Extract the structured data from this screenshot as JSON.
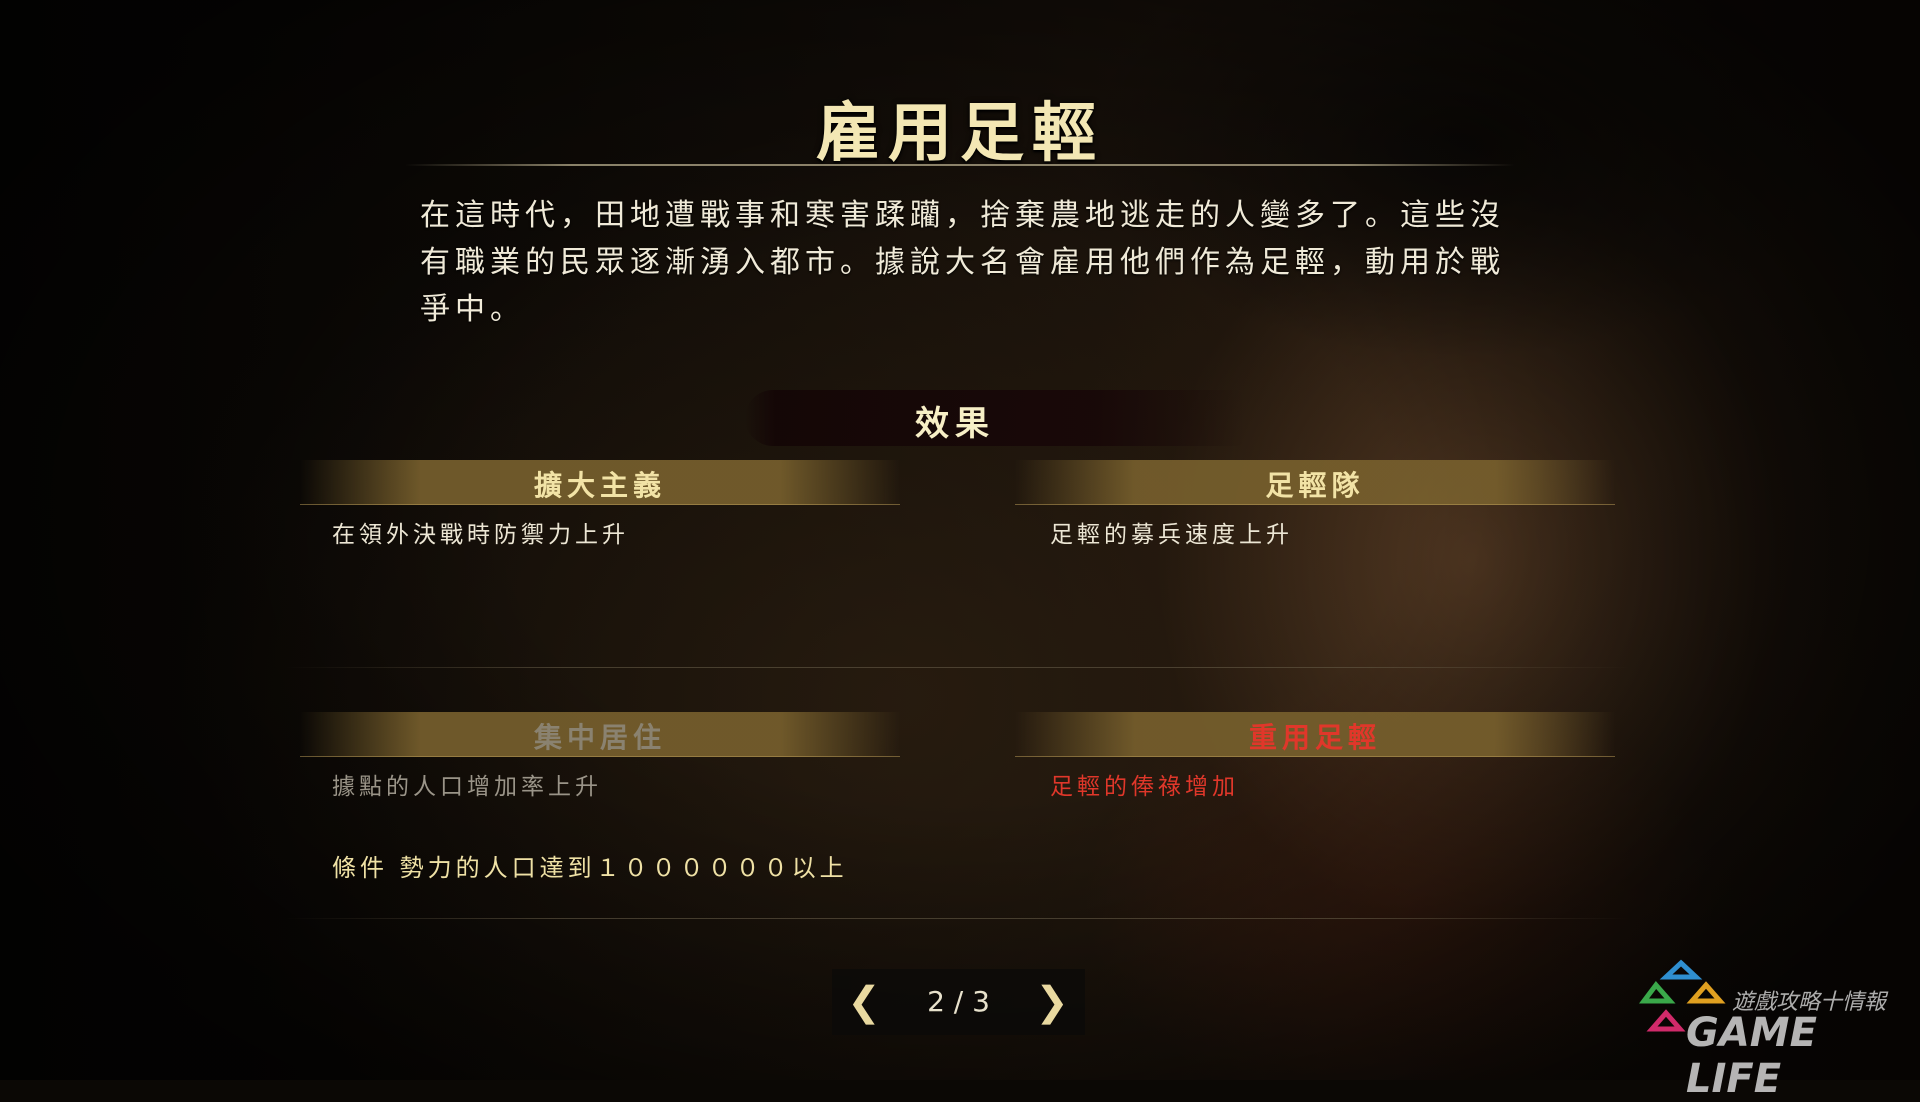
{
  "screen": {
    "title": "雇用足輕",
    "description": "在這時代，田地遭戰事和寒害蹂躪，捨棄農地逃走的人變多了。這些沒有職業的民眾逐漸湧入都市。據說大名會雇用他們作為足輕，動用於戰爭中。",
    "effect_heading": "效果"
  },
  "policies": [
    {
      "name": "擴大主義",
      "effect": "在領外決戰時防禦力上升",
      "state": "normal",
      "name_color": "#f2e3a6",
      "effect_color": "#ece6d4"
    },
    {
      "name": "足輕隊",
      "effect": "足輕的募兵速度上升",
      "state": "normal",
      "name_color": "#f2e3a6",
      "effect_color": "#ece6d4"
    },
    {
      "name": "集中居住",
      "effect": "據點的人口增加率上升",
      "state": "locked",
      "name_color": "#8a8270",
      "effect_color": "#9a9488"
    },
    {
      "name": "重用足輕",
      "effect": "足輕的俸祿增加",
      "state": "negative",
      "name_color": "#e0372a",
      "effect_color": "#e0372a"
    }
  ],
  "condition": {
    "label": "條件",
    "text": "勢力的人口達到１００００００以上"
  },
  "pager": {
    "text": "2 / 3",
    "prev_icon": "chevron-left-icon",
    "next_icon": "chevron-right-icon"
  },
  "watermark": {
    "top": "遊戲攻略十情報",
    "bottom": "GAME LIFE"
  }
}
